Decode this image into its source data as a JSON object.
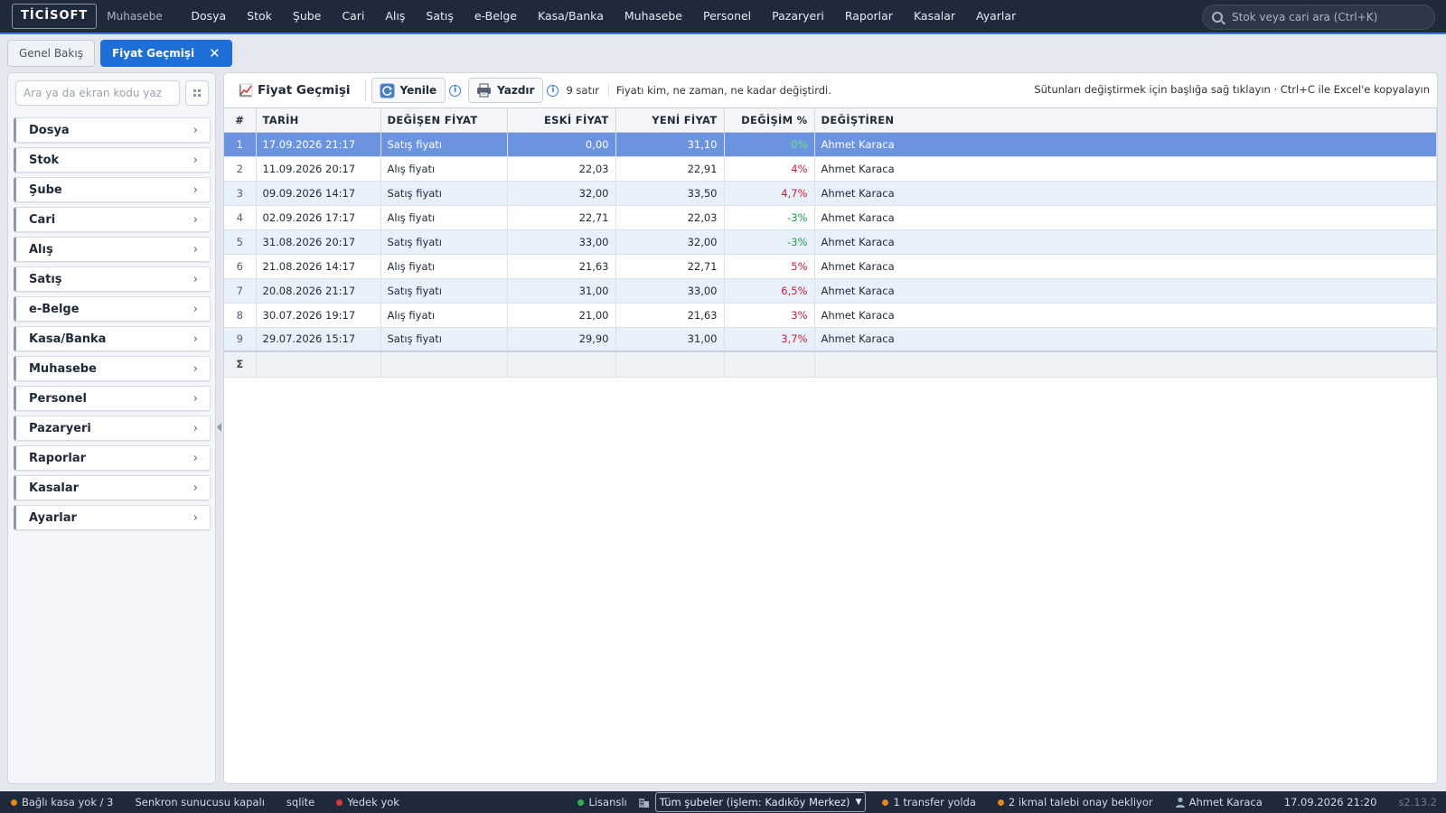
{
  "app": {
    "logo": "TİCİSOFT",
    "module": "Muhasebe"
  },
  "menu": [
    "Dosya",
    "Stok",
    "Şube",
    "Cari",
    "Alış",
    "Satış",
    "e-Belge",
    "Kasa/Banka",
    "Muhasebe",
    "Personel",
    "Pazaryeri",
    "Raporlar",
    "Kasalar",
    "Ayarlar"
  ],
  "search": {
    "placeholder": "Stok veya cari ara (Ctrl+K)"
  },
  "tabs": [
    {
      "label": "Genel Bakış",
      "active": false
    },
    {
      "label": "Fiyat Geçmişi",
      "active": true,
      "close": "✕"
    }
  ],
  "sidebar": {
    "search_placeholder": "Ara ya da ekran kodu yaz",
    "items": [
      "Dosya",
      "Stok",
      "Şube",
      "Cari",
      "Alış",
      "Satış",
      "e-Belge",
      "Kasa/Banka",
      "Muhasebe",
      "Personel",
      "Pazaryeri",
      "Raporlar",
      "Kasalar",
      "Ayarlar"
    ]
  },
  "toolbar": {
    "title": "Fiyat Geçmişi",
    "refresh_label": "Yenile",
    "print_label": "Yazdır",
    "row_count": "9 satır",
    "description": "Fiyatı kim, ne zaman, ne kadar değiştirdi.",
    "hint": "Sütunları değiştirmek için başlığa sağ tıklayın · Ctrl+C ile Excel'e kopyalayın"
  },
  "table": {
    "columns": [
      "#",
      "TARİH",
      "DEĞİŞEN FİYAT",
      "ESKİ FİYAT",
      "YENİ FİYAT",
      "DEĞİŞİM %",
      "DEĞİŞTİREN"
    ],
    "rows": [
      {
        "n": "1",
        "date": "17.09.2026 21:17",
        "type": "Satış fiyatı",
        "old": "0,00",
        "new": "31,10",
        "pct": "0%",
        "trend": "pos",
        "by": "Ahmet Karaca"
      },
      {
        "n": "2",
        "date": "11.09.2026 20:17",
        "type": "Alış fiyatı",
        "old": "22,03",
        "new": "22,91",
        "pct": "4%",
        "trend": "up",
        "by": "Ahmet Karaca"
      },
      {
        "n": "3",
        "date": "09.09.2026 14:17",
        "type": "Satış fiyatı",
        "old": "32,00",
        "new": "33,50",
        "pct": "4,7%",
        "trend": "up",
        "by": "Ahmet Karaca"
      },
      {
        "n": "4",
        "date": "02.09.2026 17:17",
        "type": "Alış fiyatı",
        "old": "22,71",
        "new": "22,03",
        "pct": "-3%",
        "trend": "neg",
        "by": "Ahmet Karaca"
      },
      {
        "n": "5",
        "date": "31.08.2026 20:17",
        "type": "Satış fiyatı",
        "old": "33,00",
        "new": "32,00",
        "pct": "-3%",
        "trend": "neg",
        "by": "Ahmet Karaca"
      },
      {
        "n": "6",
        "date": "21.08.2026 14:17",
        "type": "Alış fiyatı",
        "old": "21,63",
        "new": "22,71",
        "pct": "5%",
        "trend": "up",
        "by": "Ahmet Karaca"
      },
      {
        "n": "7",
        "date": "20.08.2026 21:17",
        "type": "Satış fiyatı",
        "old": "31,00",
        "new": "33,00",
        "pct": "6,5%",
        "trend": "up",
        "by": "Ahmet Karaca"
      },
      {
        "n": "8",
        "date": "30.07.2026 19:17",
        "type": "Alış fiyatı",
        "old": "21,00",
        "new": "21,63",
        "pct": "3%",
        "trend": "up",
        "by": "Ahmet Karaca"
      },
      {
        "n": "9",
        "date": "29.07.2026 15:17",
        "type": "Satış fiyatı",
        "old": "29,90",
        "new": "31,00",
        "pct": "3,7%",
        "trend": "up",
        "by": "Ahmet Karaca"
      }
    ],
    "selected_row": 1,
    "sum_label": "Σ"
  },
  "status": {
    "kasa": "Bağlı kasa yok / 3",
    "sync": "Senkron sunucusu kapalı",
    "db": "sqlite",
    "backup": "Yedek yok",
    "license": "Lisanslı",
    "branch_select": "Tüm şubeler (işlem: Kadıköy Merkez)",
    "transfer": "1 transfer yolda",
    "pending": "2 ikmal talebi onay bekliyor",
    "user": "Ahmet Karaca",
    "datetime": "17.09.2026 21:20",
    "version": "s2.13.2"
  },
  "colors": {
    "topbar": "#1e2a3b",
    "accent": "#1f6fd8",
    "selected_row": "#6b93e0",
    "positive": "#1e9a4a",
    "increase": "#c2203a",
    "status_orange": "#e08a1e",
    "status_red": "#d63a3a",
    "status_green": "#2fb34a"
  }
}
